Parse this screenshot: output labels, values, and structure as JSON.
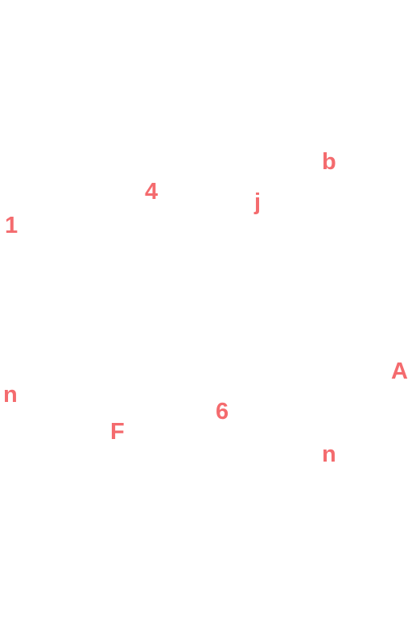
{
  "accent_color": "#f46b6e",
  "glyphs": [
    {
      "char": "b"
    },
    {
      "char": "4"
    },
    {
      "char": "j"
    },
    {
      "char": "1"
    },
    {
      "char": "A"
    },
    {
      "char": "n"
    },
    {
      "char": "6"
    },
    {
      "char": "F"
    },
    {
      "char": "n"
    }
  ]
}
